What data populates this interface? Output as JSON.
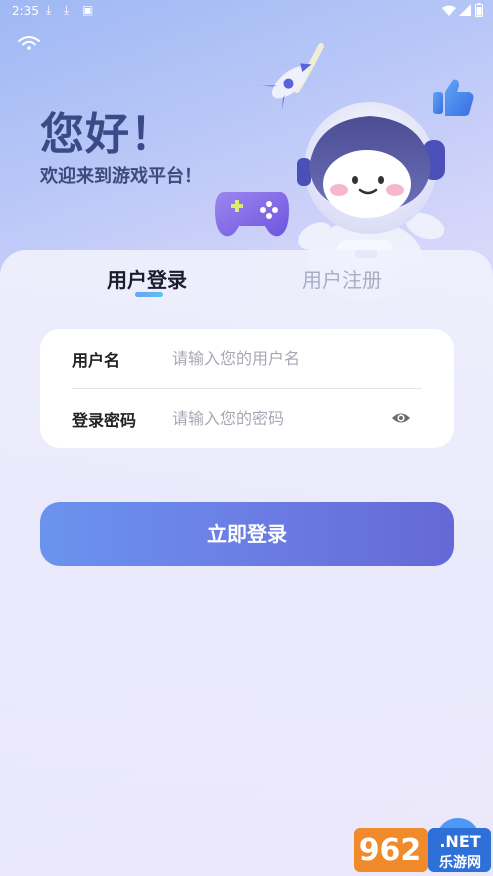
{
  "status_bar": {
    "time": "2:35",
    "icons": [
      "download-icon",
      "download-icon",
      "notification-icon",
      "wifi-icon",
      "signal-icon",
      "battery-icon"
    ]
  },
  "header": {
    "greeting": "您好！",
    "welcome": "欢迎来到游戏平台！"
  },
  "tabs": [
    {
      "label": "用户登录",
      "active": true
    },
    {
      "label": "用户注册",
      "active": false
    }
  ],
  "form": {
    "username": {
      "label": "用户名",
      "placeholder": "请输入您的用户名",
      "value": ""
    },
    "password": {
      "label": "登录密码",
      "placeholder": "请输入您的密码",
      "value": ""
    }
  },
  "login_button": {
    "label": "立即登录"
  },
  "watermark": {
    "brand": "962",
    "suffix": ".NET",
    "caption": "乐游网"
  },
  "colors": {
    "accent": "#6b7ee4",
    "title": "#3a4a86",
    "tab_indicator": "#6aa0f5"
  }
}
